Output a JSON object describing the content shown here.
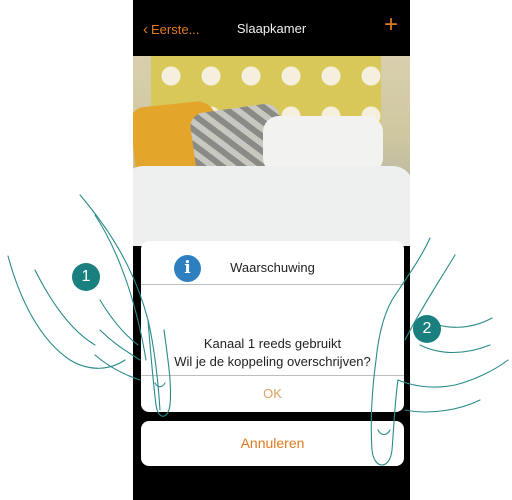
{
  "header": {
    "back_label": "Eerste...",
    "title": "Slaapkamer",
    "add_icon": "plus-icon"
  },
  "dialog": {
    "icon": "info-icon",
    "icon_glyph": "i",
    "title": "Waarschuwing",
    "message_line1": "Kanaal 1 reeds gebruikt",
    "message_line2": "Wil je de koppeling overschrijven?",
    "ok_label": "OK",
    "cancel_label": "Annuleren"
  },
  "annotations": {
    "step1": "1",
    "step2": "2"
  },
  "colors": {
    "accent": "#e07a1f",
    "badge": "#1a7f7f",
    "info": "#2e7fc0"
  }
}
